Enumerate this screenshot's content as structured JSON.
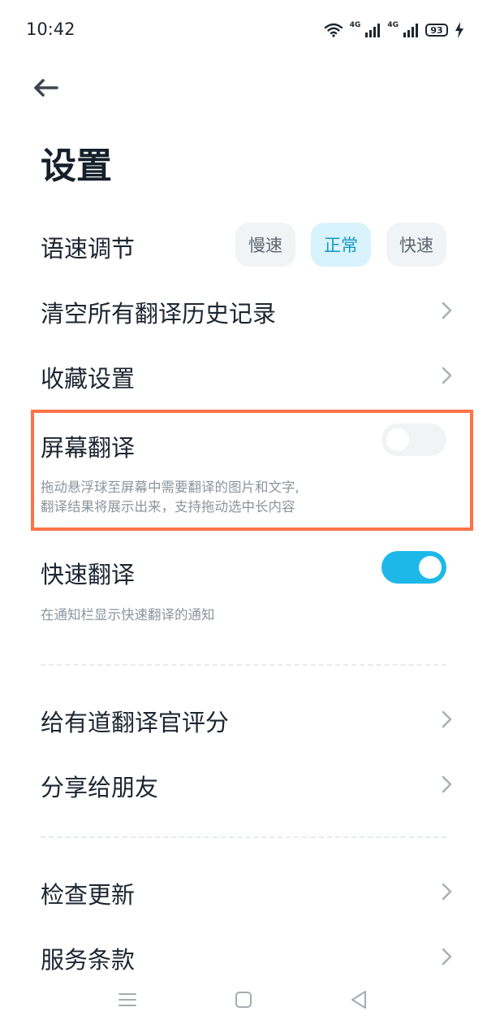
{
  "status_bar": {
    "time": "10:42",
    "network_1": "4G",
    "network_2": "4G",
    "battery": "93",
    "icons": [
      "wifi-icon",
      "signal-icon",
      "signal-icon",
      "battery-icon",
      "charging-bolt-icon"
    ]
  },
  "header": {
    "back_icon": "arrow-left-icon",
    "title": "设置"
  },
  "speed": {
    "label": "语速调节",
    "options": [
      "慢速",
      "正常",
      "快速"
    ],
    "selected": "正常"
  },
  "rows": {
    "clear_history": "清空所有翻译历史记录",
    "favorites": "收藏设置",
    "rate_app": "给有道翻译官评分",
    "share": "分享给朋友",
    "check_update": "检查更新",
    "terms": "服务条款"
  },
  "screen_translate": {
    "label": "屏幕翻译",
    "enabled": false,
    "desc_line1": "拖动悬浮球至屏幕中需要翻译的图片和文字,",
    "desc_line2": "翻译结果将展示出来，支持拖动选中长内容"
  },
  "quick_translate": {
    "label": "快速翻译",
    "enabled": true,
    "desc": "在通知栏显示快速翻译的通知"
  },
  "nav": {
    "icons": [
      "menu-icon",
      "home-square-icon",
      "back-triangle-icon"
    ]
  },
  "colors": {
    "accent": "#1eb8e8",
    "selected_chip_bg": "#d8f3fb",
    "highlight_border": "#fd7348",
    "text_primary": "#1c2630",
    "text_secondary": "#8b959e"
  }
}
